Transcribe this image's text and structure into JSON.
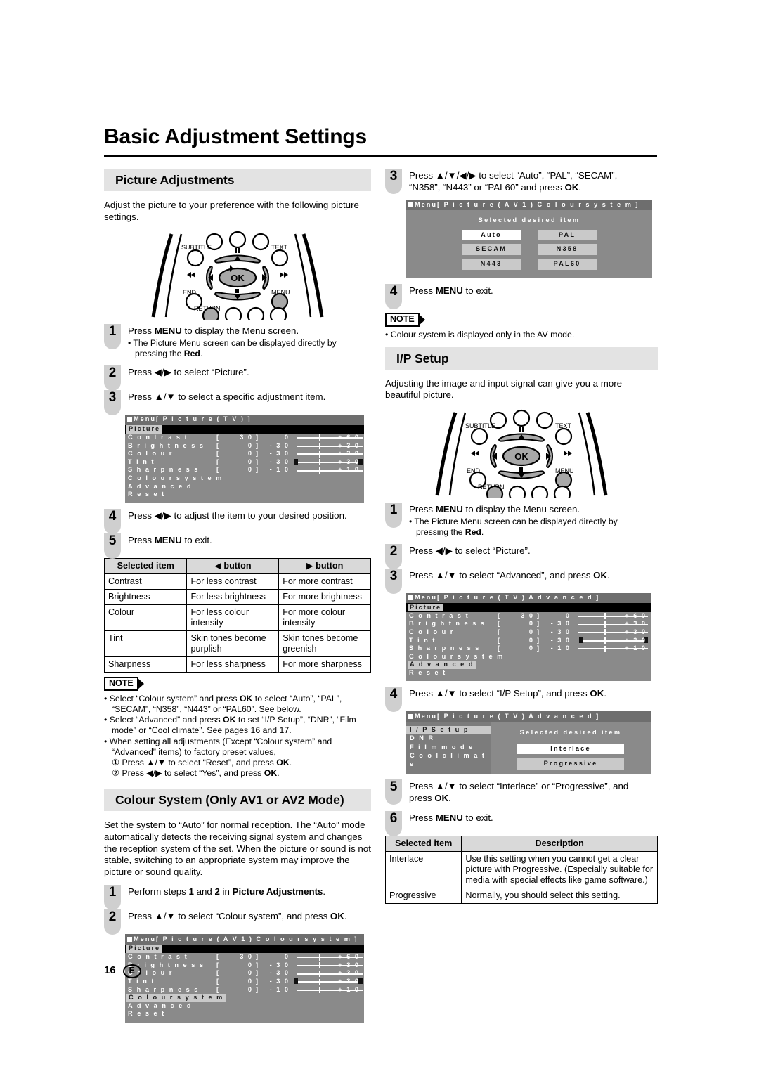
{
  "document": {
    "title": "Basic Adjustment Settings",
    "page_number": "16",
    "region_code": "E"
  },
  "left_column": {
    "picture_adjustments": {
      "heading": "Picture Adjustments",
      "intro": "Adjust the picture to your preference with the following picture settings.",
      "remote_labels": {
        "subtitle": "SUBTITLE",
        "text": "TEXT",
        "end": "END",
        "menu": "MENU",
        "return": "RETURN",
        "ok": "OK"
      },
      "steps": [
        {
          "num": "1",
          "text_html": "Press <b>MENU</b> to display the Menu screen.",
          "sub": "• The Picture Menu screen can be displayed directly by",
          "sub2": "pressing the <b>Red</b>."
        },
        {
          "num": "2",
          "text_html": "Press ◀/▶ to select “Picture”."
        },
        {
          "num": "3",
          "text_html": "Press ▲/▼ to select a specific adjustment item."
        },
        {
          "num": "4",
          "text_html": "Press ◀/▶ to adjust the item to your desired position."
        },
        {
          "num": "5",
          "text_html": "Press <b>MENU</b> to exit."
        }
      ],
      "osd_title": "Menu[ P i c t u r e ( T V ) ]",
      "table": {
        "headers": [
          "Selected item",
          "◀ button",
          "▶ button"
        ],
        "rows": [
          [
            "Contrast",
            "For less contrast",
            "For more contrast"
          ],
          [
            "Brightness",
            "For less brightness",
            "For more brightness"
          ],
          [
            "Colour",
            "For less colour intensity",
            "For more colour intensity"
          ],
          [
            "Tint",
            "Skin tones become purplish",
            "Skin tones become greenish"
          ],
          [
            "Sharpness",
            "For less sharpness",
            "For more sharpness"
          ]
        ]
      },
      "note": {
        "label": "NOTE",
        "items": [
          "• Select “Colour system” and press <b>OK</b> to select “Auto”, “PAL”, “SECAM”, “N358”, “N443” or “PAL60”. See below.",
          "• Select “Advanced” and press <b>OK</b> to set “I/P Setup”, “DNR”, “Film mode” or “Cool climate”. See pages 16 and 17.",
          "• When setting all adjustments (Except “Colour system” and “Advanced” items) to factory preset values,"
        ],
        "sub_items": [
          "① Press ▲/▼ to select “Reset”, and press <b>OK</b>.",
          "② Press ◀/▶ to select “Yes”, and press <b>OK</b>."
        ]
      }
    },
    "colour_system": {
      "heading": "Colour System (Only AV1 or AV2 Mode)",
      "intro": "Set the system to “Auto” for normal reception. The “Auto” mode automatically detects the receiving signal system and changes the reception system of the set. When the picture or sound is not stable, switching to an appropriate system may improve the picture or sound quality.",
      "steps": [
        {
          "num": "1",
          "text_html": "Perform steps <b>1</b> and <b>2</b> in <b>Picture Adjustments</b>."
        },
        {
          "num": "2",
          "text_html": "Press ▲/▼ to select “Colour system”, and press <b>OK</b>."
        }
      ],
      "osd_title": "Menu[ P i c t u r e ( A V 1 ) C o l o u r   s y s t e m ]"
    }
  },
  "right_column": {
    "colour_system_cont": {
      "steps": [
        {
          "num": "3",
          "text_html": "Press ▲/▼/◀/▶ to select “Auto”, “PAL”, “SECAM”,",
          "line2_html": "“N358”, “N443” or “PAL60” and press <b>OK</b>."
        },
        {
          "num": "4",
          "text_html": "Press <b>MENU</b> to exit."
        }
      ],
      "osd": {
        "title": "Menu[ P i c t u r e ( A V 1 ) C o l o u r   s y s t e m ]",
        "prompt": "Selected desired item",
        "options_left": [
          "Auto",
          "SECAM",
          "N443"
        ],
        "options_right": [
          "PAL",
          "N358",
          "PAL60"
        ],
        "selected": "Auto"
      },
      "note": {
        "label": "NOTE",
        "items": [
          "• Colour system is displayed only in the AV mode."
        ]
      }
    },
    "ip_setup": {
      "heading": "I/P Setup",
      "intro": "Adjusting the image and input signal can give you a more beautiful picture.",
      "remote_labels": {
        "subtitle": "SUBTITLE",
        "text": "TEXT",
        "end": "END",
        "menu": "MENU",
        "return": "RETURN",
        "ok": "OK"
      },
      "steps": [
        {
          "num": "1",
          "text_html": "Press <b>MENU</b> to display the Menu screen.",
          "sub": "• The Picture Menu screen can be displayed directly by",
          "sub2": "pressing the <b>Red</b>."
        },
        {
          "num": "2",
          "text_html": "Press ◀/▶ to select “Picture”."
        },
        {
          "num": "3",
          "text_html": "Press ▲/▼ to select “Advanced”, and press <b>OK</b>."
        },
        {
          "num": "4",
          "text_html": "Press ▲/▼ to select “I/P Setup”, and press <b>OK</b>."
        },
        {
          "num": "5",
          "text_html": "Press ▲/▼ to select “Interlace” or “Progressive”, and",
          "line2_html": "press <b>OK</b>."
        },
        {
          "num": "6",
          "text_html": "Press <b>MENU</b> to exit."
        }
      ],
      "osd_advanced_title": "Menu[ P i c t u r e ( T V ) A d v a n c e d ]",
      "osd_ip": {
        "title": "Menu[ P i c t u r e ( T V ) A d v a n c e d ]",
        "menu_items": [
          "I / P   S e t u p",
          "D N R",
          "F i l m   m o d e",
          "C o o l   c l i m a t e"
        ],
        "selected_menu_item": "I / P   S e t u p",
        "prompt": "Selected desired item",
        "options": [
          "Interlace",
          "Progressive"
        ],
        "selected": "Interlace"
      },
      "table": {
        "headers": [
          "Selected item",
          "Description"
        ],
        "rows": [
          [
            "Interlace",
            "Use this setting when you cannot get a clear picture with Progressive. (Especially suitable for media with special effects like game software.)"
          ],
          [
            "Progressive",
            "Normally, you should select this setting."
          ]
        ]
      }
    }
  },
  "osd_picture_menu": {
    "header_label": "Picture",
    "items": [
      {
        "label": "C o n t r a s t",
        "bracket": "[",
        "value": "3 0",
        "bracket2": "]",
        "low": "0",
        "high": "+ 6 0"
      },
      {
        "label": "B r i g h t n e s s",
        "bracket": "[",
        "value": "0",
        "bracket2": "]",
        "low": "- 3 0",
        "high": "+ 3 0"
      },
      {
        "label": "C o l o u r",
        "bracket": "[",
        "value": "0",
        "bracket2": "]",
        "low": "- 3 0",
        "high": "+ 3 0"
      },
      {
        "label": "T i n t",
        "bracket": "[",
        "value": "0",
        "bracket2": "]",
        "low": "- 3 0",
        "high": "+ 3 0"
      },
      {
        "label": "S h a r p n e s s",
        "bracket": "[",
        "value": "0",
        "bracket2": "]",
        "low": "- 1 0",
        "high": "+ 1 0"
      }
    ],
    "extra_items": [
      "C o l o u r   s y s t e m",
      "A d v a n c e d",
      "R e s e t"
    ]
  },
  "colors": {
    "section_bar": "#e3e3e3",
    "step_pill": "#cfcfcf",
    "osd_bg": "#8a8a8a",
    "osd_titlebar": "#6e6e6e",
    "osd_highlight": "#c9c9c9",
    "table_header": "#d9d9d9"
  }
}
